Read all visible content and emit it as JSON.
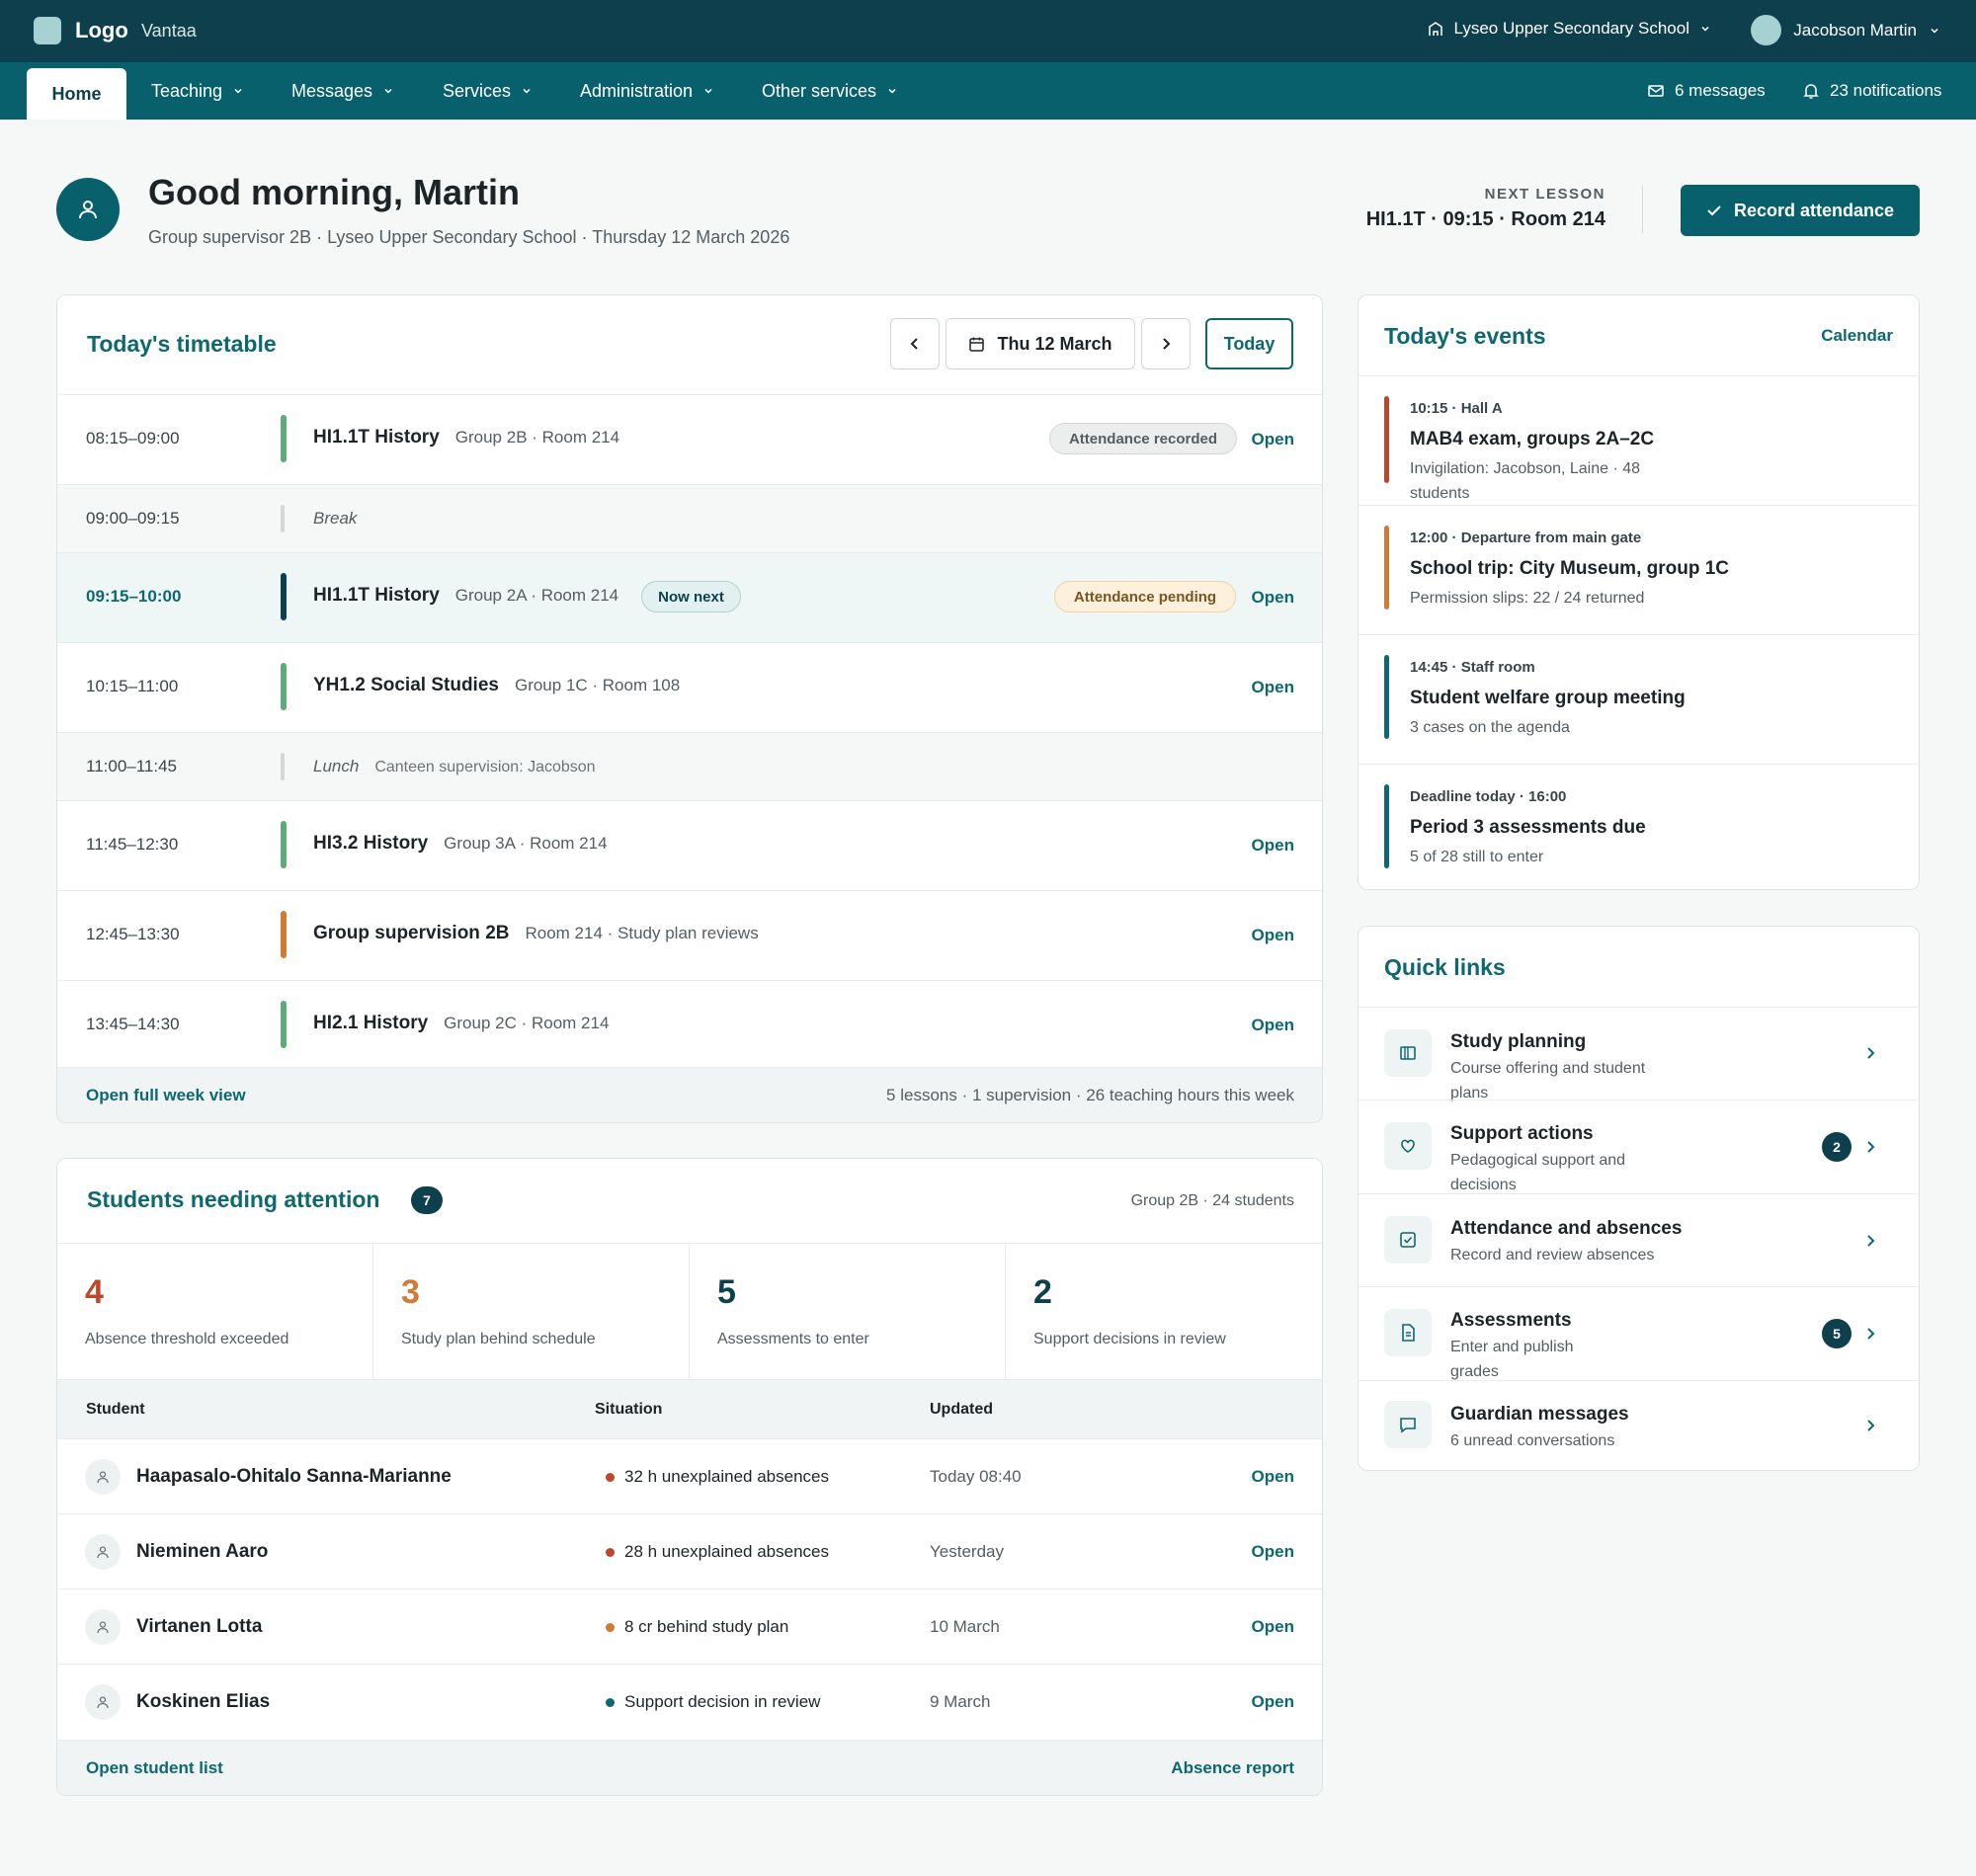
{
  "colors": {
    "primary": "#0e3f4d",
    "accent": "#07606b",
    "link": "#0d6870",
    "red": "#c0462a",
    "orange": "#d07a35",
    "green": "#5fa97a"
  },
  "topbar": {
    "logo": "Logo",
    "city": "Vantaa",
    "school": "Lyseo Upper Secondary School",
    "user": "Jacobson Martin"
  },
  "nav": {
    "items": [
      "Home",
      "Teaching",
      "Messages",
      "Services",
      "Administration",
      "Other services"
    ],
    "messages": "6 messages",
    "notifications": "23 notifications"
  },
  "header": {
    "greeting": "Good morning, Martin",
    "subline": "Group supervisor 2B · Lyseo Upper Secondary School · Thursday 12 March 2026",
    "next_label": "NEXT LESSON",
    "next_value": "HI1.1T · 09:15 · Room 214",
    "record_btn": "Record attendance"
  },
  "timetable": {
    "title": "Today's timetable",
    "date": "Thu 12 March",
    "today_btn": "Today",
    "rows": [
      {
        "time": "08:15–09:00",
        "title": "HI1.1T History",
        "meta": "Group 2B · Room 214",
        "status": "Attendance recorded",
        "action": "Open"
      },
      {
        "time": "09:00–09:15",
        "title": "Break"
      },
      {
        "time": "09:15–10:00",
        "title": "HI1.1T History",
        "meta": "Group 2A · Room 214",
        "tag": "Now next",
        "status": "Attendance pending",
        "action": "Open"
      },
      {
        "time": "10:15–11:00",
        "title": "YH1.2 Social Studies",
        "meta": "Group 1C · Room 108",
        "action": "Open"
      },
      {
        "time": "11:00–11:45",
        "title": "Lunch",
        "meta": "Canteen supervision: Jacobson"
      },
      {
        "time": "11:45–12:30",
        "title": "HI3.2 History",
        "meta": "Group 3A · Room 214",
        "action": "Open"
      },
      {
        "time": "12:45–13:30",
        "title": "Group supervision 2B",
        "meta": "Room 214 · Study plan reviews",
        "action": "Open"
      },
      {
        "time": "13:45–14:30",
        "title": "HI2.1 History",
        "meta": "Group 2C · Room 214",
        "action": "Open"
      }
    ],
    "footer_link": "Open full week view",
    "footer_summary": "5 lessons · 1 supervision · 26 teaching hours this week"
  },
  "students": {
    "title": "Students needing attention",
    "count": "7",
    "group": "Group 2B · 24 students",
    "stats": [
      {
        "num": "4",
        "label": "Absence threshold exceeded"
      },
      {
        "num": "3",
        "label": "Study plan behind schedule"
      },
      {
        "num": "5",
        "label": "Assessments to enter"
      },
      {
        "num": "2",
        "label": "Support decisions in review"
      }
    ],
    "headers": [
      "Student",
      "Situation",
      "Updated"
    ],
    "rows": [
      {
        "name": "Haapasalo-Ohitalo Sanna-Marianne",
        "situation": "32 h unexplained absences",
        "updated": "Today 08:40",
        "action": "Open"
      },
      {
        "name": "Nieminen Aaro",
        "situation": "28 h unexplained absences",
        "updated": "Yesterday",
        "action": "Open"
      },
      {
        "name": "Virtanen Lotta",
        "situation": "8 cr behind study plan",
        "updated": "10 March",
        "action": "Open"
      },
      {
        "name": "Koskinen Elias",
        "situation": "Support decision in review",
        "updated": "9 March",
        "action": "Open"
      }
    ],
    "footer_left": "Open student list",
    "footer_right": "Absence report"
  },
  "events": {
    "title": "Today's events",
    "calendar": "Calendar",
    "items": [
      {
        "time": "10:15 · Hall A",
        "title": "MAB4 exam, groups 2A–2C",
        "sub": "Invigilation: Jacobson, Laine · 48 students"
      },
      {
        "time": "12:00 · Departure from main gate",
        "title": "School trip: City Museum, group 1C",
        "sub": "Permission slips: 22 / 24 returned"
      },
      {
        "time": "14:45 · Staff room",
        "title": "Student welfare group meeting",
        "sub": "3 cases on the agenda"
      },
      {
        "time": "Deadline today · 16:00",
        "title": "Period 3 assessments due",
        "sub": "5 of 28 still to enter"
      }
    ]
  },
  "quick_links": {
    "title": "Quick links",
    "items": [
      {
        "icon": "book-icon",
        "title": "Study planning",
        "sub": "Course offering and student plans"
      },
      {
        "icon": "heart-icon",
        "title": "Support actions",
        "sub": "Pedagogical support and decisions",
        "badge": "2"
      },
      {
        "icon": "checkbox-icon",
        "title": "Attendance and absences",
        "sub": "Record and review absences"
      },
      {
        "icon": "document-icon",
        "title": "Assessments",
        "sub": "Enter and publish grades",
        "badge": "5"
      },
      {
        "icon": "chat-icon",
        "title": "Guardian messages",
        "sub": "6 unread conversations"
      }
    ]
  }
}
